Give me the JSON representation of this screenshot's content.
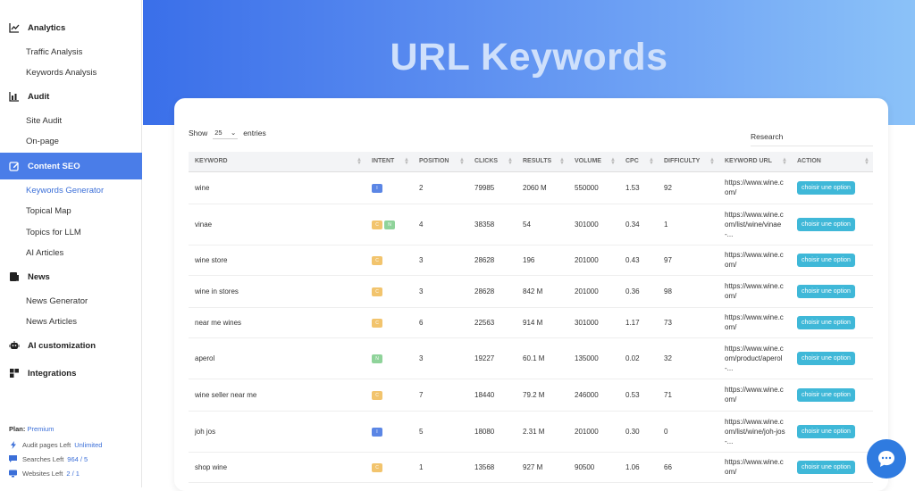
{
  "sidebar": {
    "sections": [
      {
        "label": "Analytics",
        "icon": "chart-line-icon"
      },
      {
        "label": "Audit",
        "icon": "bar-chart-icon"
      },
      {
        "label": "Content SEO",
        "icon": "edit-icon"
      },
      {
        "label": "News",
        "icon": "news-icon"
      },
      {
        "label": "AI customization",
        "icon": "robot-icon"
      },
      {
        "label": "Integrations",
        "icon": "puzzle-icon"
      }
    ],
    "items": [
      "Traffic Analysis",
      "Keywords Analysis",
      "Site Audit",
      "On-page",
      "Keywords Generator",
      "Topical Map",
      "Topics for LLM",
      "AI Articles",
      "News Generator",
      "News Articles"
    ],
    "plan_label": "Plan:",
    "plan_value": "Premium",
    "limits": [
      {
        "label": "Audit pages Left",
        "value": "Unlimited",
        "icon": "bolt-icon"
      },
      {
        "label": "Searches Left",
        "value": "964 / 5",
        "icon": "chat-icon"
      },
      {
        "label": "Websites Left",
        "value": "2 / 1",
        "icon": "monitor-icon"
      }
    ]
  },
  "header": {
    "title": "URL Keywords"
  },
  "table_controls": {
    "show_label": "Show",
    "entries_value": "25",
    "entries_label": "entries",
    "search_label": "Research"
  },
  "columns": [
    "KEYWORD",
    "INTENT",
    "POSITION",
    "CLICKS",
    "RESULTS",
    "VOLUME",
    "CPC",
    "DIFFICULTY",
    "KEYWORD URL",
    "ACTION"
  ],
  "action_label": "choisir une option",
  "rows": [
    {
      "keyword": "wine",
      "intent": [
        "I"
      ],
      "position": "2",
      "clicks": "79985",
      "results": "2060 M",
      "volume": "550000",
      "cpc": "1.53",
      "difficulty": "92",
      "url": "https://www.wine.com/"
    },
    {
      "keyword": "vinae",
      "intent": [
        "C",
        "N"
      ],
      "position": "4",
      "clicks": "38358",
      "results": "54",
      "volume": "301000",
      "cpc": "0.34",
      "difficulty": "1",
      "url": "https://www.wine.com/list/wine/vinae-..."
    },
    {
      "keyword": "wine store",
      "intent": [
        "C"
      ],
      "position": "3",
      "clicks": "28628",
      "results": "196",
      "volume": "201000",
      "cpc": "0.43",
      "difficulty": "97",
      "url": "https://www.wine.com/"
    },
    {
      "keyword": "wine in stores",
      "intent": [
        "C"
      ],
      "position": "3",
      "clicks": "28628",
      "results": "842 M",
      "volume": "201000",
      "cpc": "0.36",
      "difficulty": "98",
      "url": "https://www.wine.com/"
    },
    {
      "keyword": "near me wines",
      "intent": [
        "C"
      ],
      "position": "6",
      "clicks": "22563",
      "results": "914 M",
      "volume": "301000",
      "cpc": "1.17",
      "difficulty": "73",
      "url": "https://www.wine.com/"
    },
    {
      "keyword": "aperol",
      "intent": [
        "N"
      ],
      "position": "3",
      "clicks": "19227",
      "results": "60.1 M",
      "volume": "135000",
      "cpc": "0.02",
      "difficulty": "32",
      "url": "https://www.wine.com/product/aperol-..."
    },
    {
      "keyword": "wine seller near me",
      "intent": [
        "C"
      ],
      "position": "7",
      "clicks": "18440",
      "results": "79.2 M",
      "volume": "246000",
      "cpc": "0.53",
      "difficulty": "71",
      "url": "https://www.wine.com/"
    },
    {
      "keyword": "joh jos",
      "intent": [
        "I"
      ],
      "position": "5",
      "clicks": "18080",
      "results": "2.31 M",
      "volume": "201000",
      "cpc": "0.30",
      "difficulty": "0",
      "url": "https://www.wine.com/list/wine/joh-jos-..."
    },
    {
      "keyword": "shop wine",
      "intent": [
        "C"
      ],
      "position": "1",
      "clicks": "13568",
      "results": "927 M",
      "volume": "90500",
      "cpc": "1.06",
      "difficulty": "66",
      "url": "https://www.wine.com/"
    }
  ]
}
